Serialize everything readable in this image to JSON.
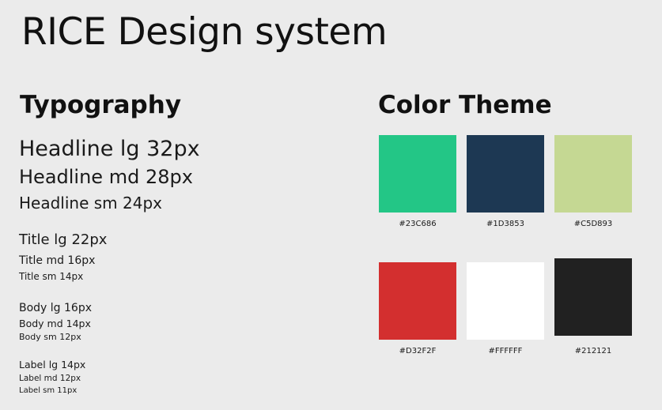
{
  "page": {
    "title": "RICE Design system"
  },
  "typography": {
    "heading": "Typography",
    "samples": {
      "headline_lg": "Headline lg 32px",
      "headline_md": "Headline md 28px",
      "headline_sm": "Headline sm 24px",
      "title_lg": "Title lg 22px",
      "title_md": "Title md 16px",
      "title_sm": "Title sm 14px",
      "body_lg": "Body lg 16px",
      "body_md": "Body md 14px",
      "body_sm": "Body sm 12px",
      "label_lg": "Label lg 14px",
      "label_md": "Label md 12px",
      "label_sm": "Label sm 11px"
    }
  },
  "color_theme": {
    "heading": "Color Theme",
    "swatches": [
      {
        "hex": "#23C686",
        "color": "#23C686"
      },
      {
        "hex": "#1D3853",
        "color": "#1D3853"
      },
      {
        "hex": "#C5D893",
        "color": "#C5D893"
      },
      {
        "hex": "#D32F2F",
        "color": "#D32F2F"
      },
      {
        "hex": "#FFFFFF",
        "color": "#FFFFFF"
      },
      {
        "hex": "#212121",
        "color": "#212121"
      }
    ]
  }
}
